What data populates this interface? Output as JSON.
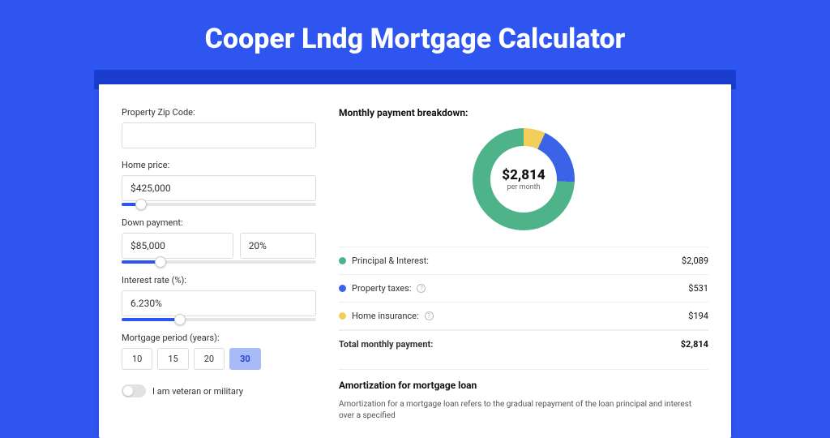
{
  "title": "Cooper Lndg Mortgage Calculator",
  "colors": {
    "accent": "#2f55f0",
    "c1": "#4fb38a",
    "c2": "#3a63e8",
    "c3": "#f2cf5b"
  },
  "form": {
    "zip_label": "Property Zip Code:",
    "zip_value": "",
    "home_price_label": "Home price:",
    "home_price_value": "$425,000",
    "home_price_pct": 10,
    "down_label": "Down payment:",
    "down_value": "$85,000",
    "down_pct_value": "20%",
    "down_slider_pct": 20,
    "rate_label": "Interest rate (%):",
    "rate_value": "6.230%",
    "rate_slider_pct": 30,
    "period_label": "Mortgage period (years):",
    "periods": [
      {
        "label": "10",
        "active": false
      },
      {
        "label": "15",
        "active": false
      },
      {
        "label": "20",
        "active": false
      },
      {
        "label": "30",
        "active": true
      }
    ],
    "veteran_label": "I am veteran or military"
  },
  "breakdown": {
    "heading": "Monthly payment breakdown:",
    "center_value": "$2,814",
    "center_sub": "per month",
    "rows": [
      {
        "dot": "c1",
        "label": "Principal & Interest:",
        "info": false,
        "value": "$2,089"
      },
      {
        "dot": "c2",
        "label": "Property taxes:",
        "info": true,
        "value": "$531"
      },
      {
        "dot": "c3",
        "label": "Home insurance:",
        "info": true,
        "value": "$194"
      }
    ],
    "total_label": "Total monthly payment:",
    "total_value": "$2,814"
  },
  "amort": {
    "heading": "Amortization for mortgage loan",
    "body": "Amortization for a mortgage loan refers to the gradual repayment of the loan principal and interest over a specified"
  },
  "chart_data": {
    "type": "pie",
    "title": "Monthly payment breakdown",
    "series": [
      {
        "name": "Principal & Interest",
        "value": 2089,
        "color": "#4fb38a"
      },
      {
        "name": "Property taxes",
        "value": 531,
        "color": "#3a63e8"
      },
      {
        "name": "Home insurance",
        "value": 194,
        "color": "#f2cf5b"
      }
    ],
    "total": 2814
  }
}
